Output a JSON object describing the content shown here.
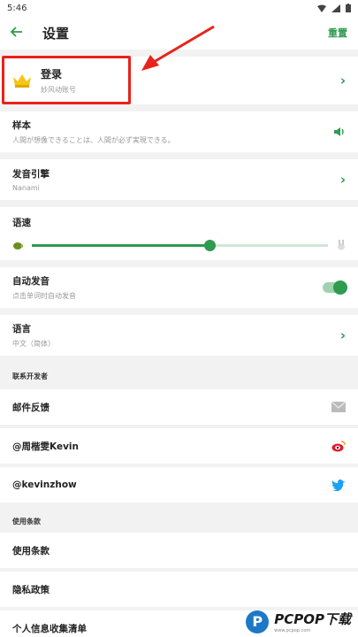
{
  "status": {
    "time": "5:46"
  },
  "appbar": {
    "title": "设置",
    "reset_label": "重置"
  },
  "login": {
    "title": "登录",
    "subtitle": "妙风动账号"
  },
  "sample": {
    "title": "样本",
    "subtitle": "人間が想像できることは、人間が必ず実現できる。"
  },
  "engine": {
    "title": "发音引擎",
    "subtitle": "Nanami"
  },
  "speed": {
    "title": "语速",
    "value_fraction": 0.6
  },
  "autoplay": {
    "title": "自动发音",
    "subtitle": "点击单词时自动发音",
    "enabled": true
  },
  "language": {
    "title": "语言",
    "subtitle": "中文（简体）"
  },
  "contact": {
    "section_label": "联系开发者",
    "email": "邮件反馈",
    "weibo": "@周楷雯Kevin",
    "twitter": "@kevinzhow"
  },
  "terms": {
    "section_label": "使用条款",
    "terms": "使用条款",
    "privacy": "隐私政策",
    "personal_info": "个人信息收集清单"
  },
  "watermark": {
    "brand": "PCPOP下载",
    "url": "www.pcpop.com"
  },
  "colors": {
    "accent": "#2e9b4f",
    "highlight": "#e8231b"
  }
}
